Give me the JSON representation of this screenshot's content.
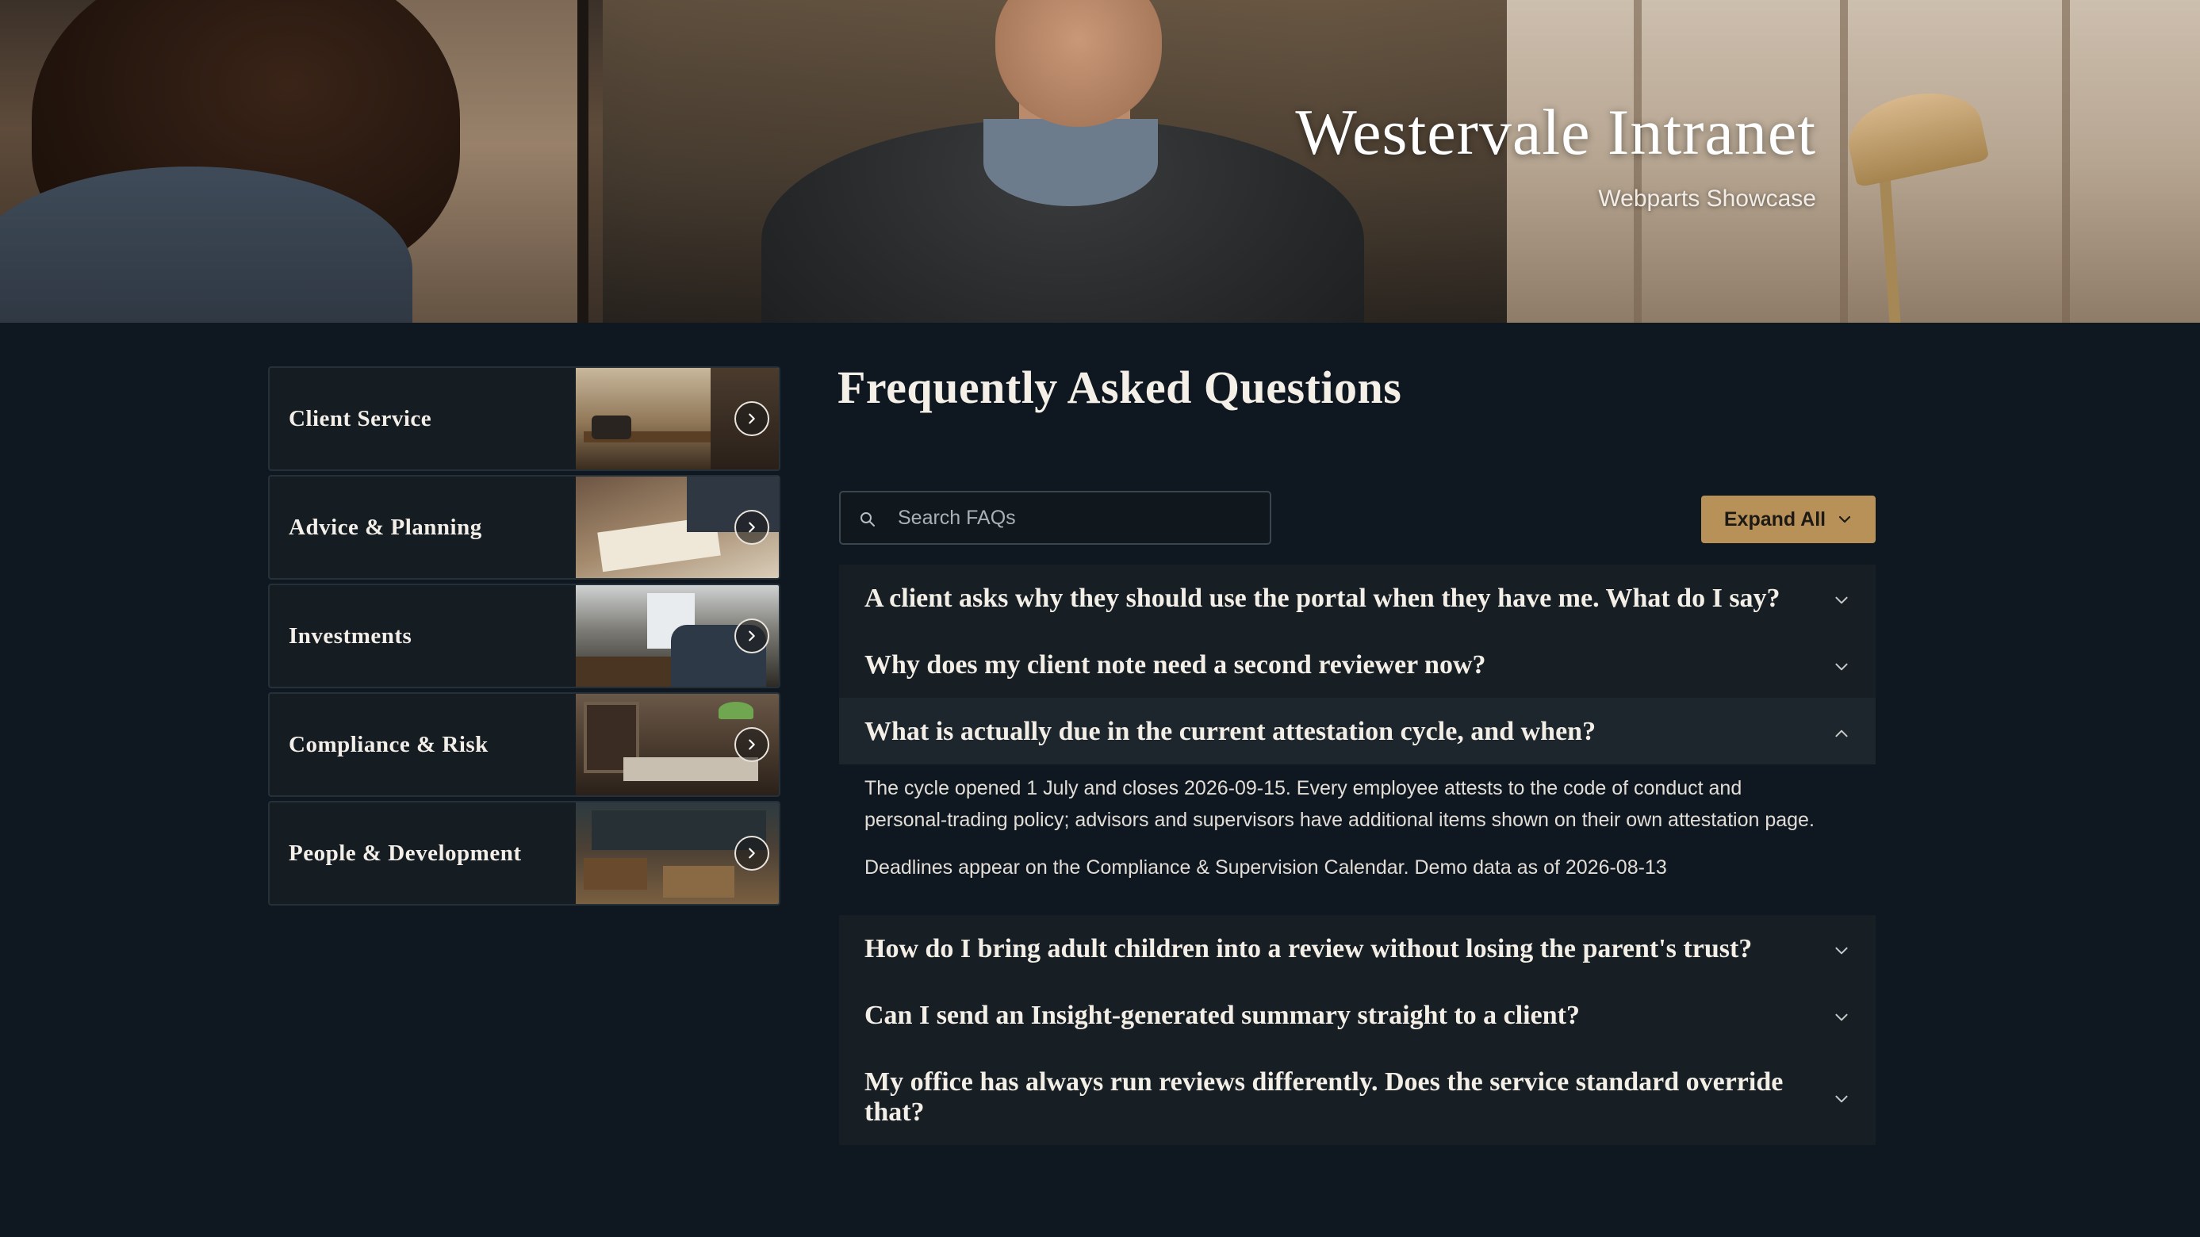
{
  "hero": {
    "title": "Westervale Intranet",
    "subtitle": "Webparts Showcase"
  },
  "nav_tiles": [
    {
      "label": "Client Service",
      "icon": "chevron-right-icon"
    },
    {
      "label": "Advice & Planning",
      "icon": "chevron-right-icon"
    },
    {
      "label": "Investments",
      "icon": "chevron-right-icon"
    },
    {
      "label": "Compliance & Risk",
      "icon": "chevron-right-icon"
    },
    {
      "label": "People & Development",
      "icon": "chevron-right-icon"
    }
  ],
  "faq": {
    "title": "Frequently Asked Questions",
    "search_placeholder": "Search FAQs",
    "search_value": "",
    "expand_all_label": "Expand All",
    "items": [
      {
        "question": "A client asks why they should use the portal when they have me. What do I say?",
        "expanded": false
      },
      {
        "question": "Why does my client note need a second reviewer now?",
        "expanded": false
      },
      {
        "question": "What is actually due in the current attestation cycle, and when?",
        "expanded": true,
        "answer": [
          "The cycle opened 1 July and closes 2026-09-15. Every employee attests to the code of conduct and personal-trading policy; advisors and supervisors have additional items shown on their own attestation page.",
          "Deadlines appear on the Compliance & Supervision Calendar. Demo data as of 2026-08-13"
        ]
      },
      {
        "question": "How do I bring adult children into a review without losing the parent's trust?",
        "expanded": false
      },
      {
        "question": "Can I send an Insight-generated summary straight to a client?",
        "expanded": false
      },
      {
        "question": "My office has always run reviews differently. Does the service standard override that?",
        "expanded": false
      }
    ]
  },
  "colors": {
    "page_bg": "#0f1820",
    "accent": "#b89158",
    "card_bg": "#171f25",
    "text": "#f3efe7"
  }
}
